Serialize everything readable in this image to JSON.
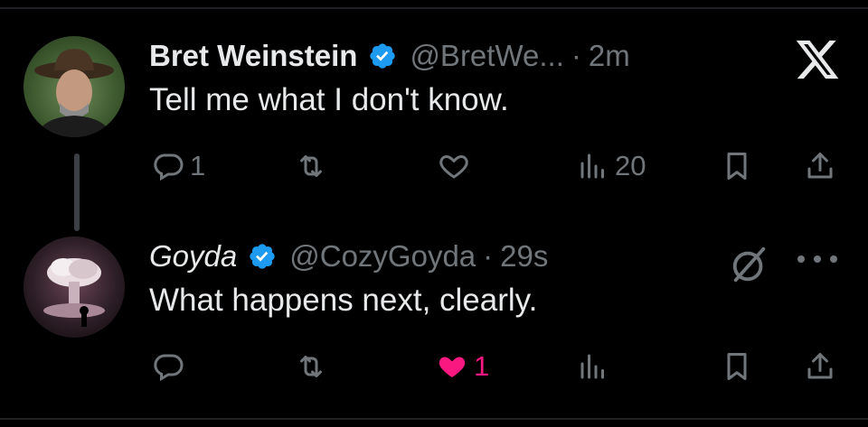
{
  "tweets": [
    {
      "name": "Bret Weinstein",
      "handle": "@BretWe...",
      "separator": "·",
      "time": "2m",
      "text": "Tell me what I don't know.",
      "stats": {
        "replies": "1",
        "retweets": "",
        "likes": "",
        "views": "20"
      }
    },
    {
      "name": "Goyda",
      "handle": "@CozyGoyda",
      "separator": "·",
      "time": "29s",
      "text": "What happens next, clearly.",
      "stats": {
        "replies": "",
        "retweets": "",
        "likes": "1",
        "views": ""
      }
    }
  ],
  "colors": {
    "background": "#000000",
    "primary_text": "#e7e9ea",
    "secondary_text": "#71767b",
    "verified_blue": "#1d9bf0",
    "like_pink": "#f91880"
  },
  "icons": [
    "x-logo-icon",
    "verified-badge-icon",
    "reply-icon",
    "retweet-icon",
    "like-icon",
    "views-icon",
    "bookmark-icon",
    "share-icon",
    "grok-icon",
    "more-icon"
  ]
}
